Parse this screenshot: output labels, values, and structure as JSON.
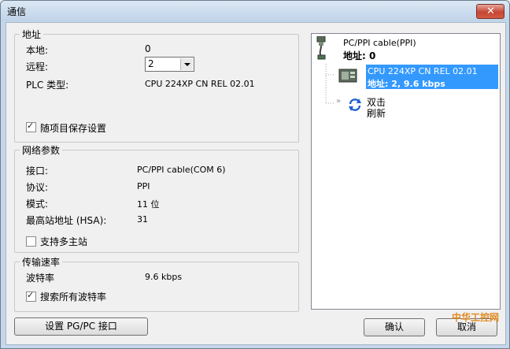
{
  "window": {
    "title": "通信"
  },
  "address_group": {
    "legend": "地址",
    "local_label": "本地:",
    "local_value": "0",
    "remote_label": "远程:",
    "remote_value": "2",
    "plc_type_label": "PLC 类型:",
    "plc_type_value": "CPU 224XP CN REL 02.01",
    "save_with_project_label": "随项目保存设置",
    "save_with_project_checked": true
  },
  "network_group": {
    "legend": "网络参数",
    "interface_label": "接口:",
    "interface_value": "PC/PPI cable(COM 6)",
    "protocol_label": "协议:",
    "protocol_value": "PPI",
    "mode_label": "模式:",
    "mode_value": "11 位",
    "hsa_label": "最高站地址 (HSA):",
    "hsa_value": "31",
    "multi_master_label": "支持多主站",
    "multi_master_checked": false
  },
  "baud_group": {
    "legend": "传输速率",
    "baud_label": "波特率",
    "baud_value": "9.6 kbps",
    "search_all_label": "搜索所有波特率",
    "search_all_checked": true
  },
  "tree": {
    "cable_name": "PC/PPI cable(PPI)",
    "cable_address": "地址: 0",
    "cpu_name": "CPU 224XP CN REL 02.01",
    "cpu_address": "地址: 2, 9.6 kbps",
    "refresh_line1": "双击",
    "refresh_line2": "刷新"
  },
  "buttons": {
    "set_pgpc": "设置 PG/PC 接口",
    "ok": "确认",
    "cancel": "取消"
  },
  "watermark": "中华工控网",
  "colors": {
    "selection": "#3399ff",
    "title_bar": "#c5d7ea",
    "close_button": "#c64534"
  }
}
